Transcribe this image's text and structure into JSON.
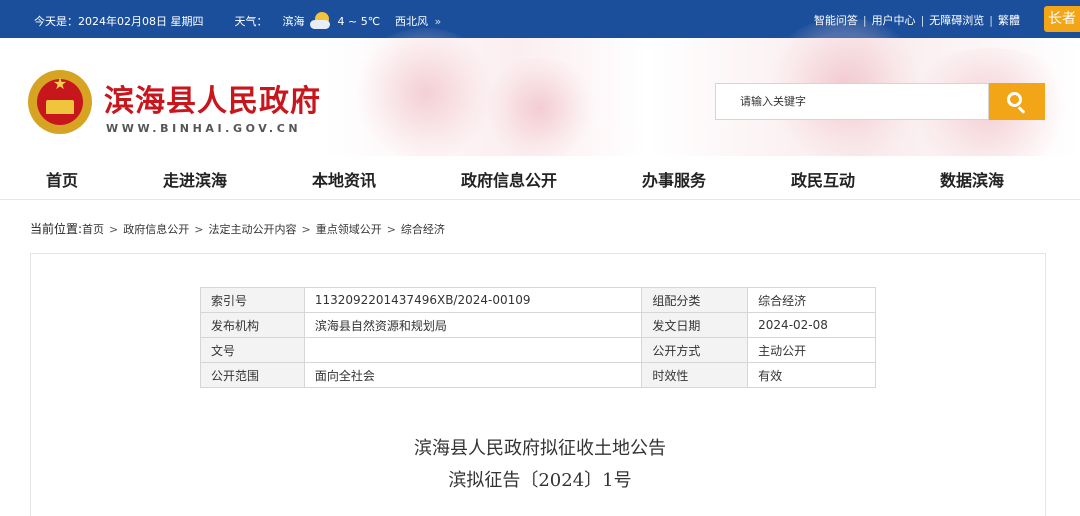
{
  "topbar": {
    "date": "今天是：2024年02月08日 星期四",
    "weather_label": "天气：",
    "city": "滨海",
    "weather_icon": "partly-cloudy-icon",
    "temp": "4 ~ 5℃",
    "wind": "西北风",
    "more": "»",
    "links": [
      "智能问答",
      "用户中心",
      "无障碍浏览",
      "繁體"
    ],
    "elder_label": "长者"
  },
  "header": {
    "title": "滨海县人民政府",
    "domain": "WWW.BINHAI.GOV.CN",
    "search_placeholder": "请输入关键字",
    "search_icon": "search-icon"
  },
  "nav": {
    "items": [
      "首页",
      "走进滨海",
      "本地资讯",
      "政府信息公开",
      "办事服务",
      "政民互动",
      "数据滨海"
    ]
  },
  "breadcrumb": {
    "lead": "当前位置:",
    "items": [
      "首页",
      "政府信息公开",
      "法定主动公开内容",
      "重点领域公开",
      "综合经济"
    ]
  },
  "info": {
    "rows": [
      [
        "索引号",
        "1132092201437496XB/2024-00109",
        "组配分类",
        "综合经济"
      ],
      [
        "发布机构",
        "滨海县自然资源和规划局",
        "发文日期",
        "2024-02-08"
      ],
      [
        "文号",
        "",
        "公开方式",
        "主动公开"
      ],
      [
        "公开范围",
        "面向全社会",
        "时效性",
        "有效"
      ]
    ]
  },
  "document": {
    "title": "滨海县人民政府拟征收土地公告",
    "number": "滨拟征告〔2024〕1号"
  },
  "colors": {
    "topbar": "#1b4f9b",
    "accent": "#f2a516",
    "title_red": "#c8161d"
  }
}
